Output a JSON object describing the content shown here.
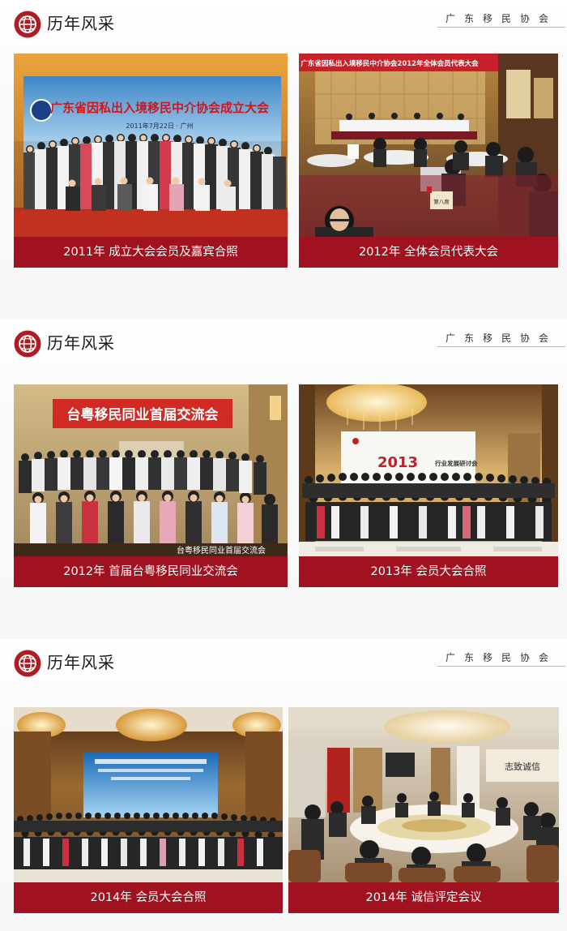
{
  "org_name": "广东移民协会",
  "colors": {
    "accent": "#a0121f",
    "logo": "#b01c23"
  },
  "icons": {
    "logo": "globe-seal-icon"
  },
  "sections": [
    {
      "title": "历年风采",
      "cards": [
        {
          "caption": "2011年 成立大会会员及嘉宾合照",
          "banner": "广东省因私出入境移民中介协会成立大会",
          "banner_sub": "2011年7月22日 · 广州"
        },
        {
          "caption": "2012年 全体会员代表大会",
          "banner": "广东省因私出入境移民中介协会2012年全体会员代表大会",
          "place_card": "第八席"
        }
      ]
    },
    {
      "title": "历年风采",
      "cards": [
        {
          "caption": "2012年 首届台粤移民同业交流会",
          "banner": "台粤移民同业首届交流会",
          "watermark": "台粤移民同业首届交流会"
        },
        {
          "caption": "2013年 会员大会合照",
          "banner": "2013",
          "banner_sub": "行业发展研讨会"
        }
      ]
    },
    {
      "title": "历年风采",
      "cards": [
        {
          "caption": "2014年 会员大会合照"
        },
        {
          "caption": "2014年 诚信评定会议",
          "plaque": "志致诚信"
        }
      ]
    }
  ]
}
